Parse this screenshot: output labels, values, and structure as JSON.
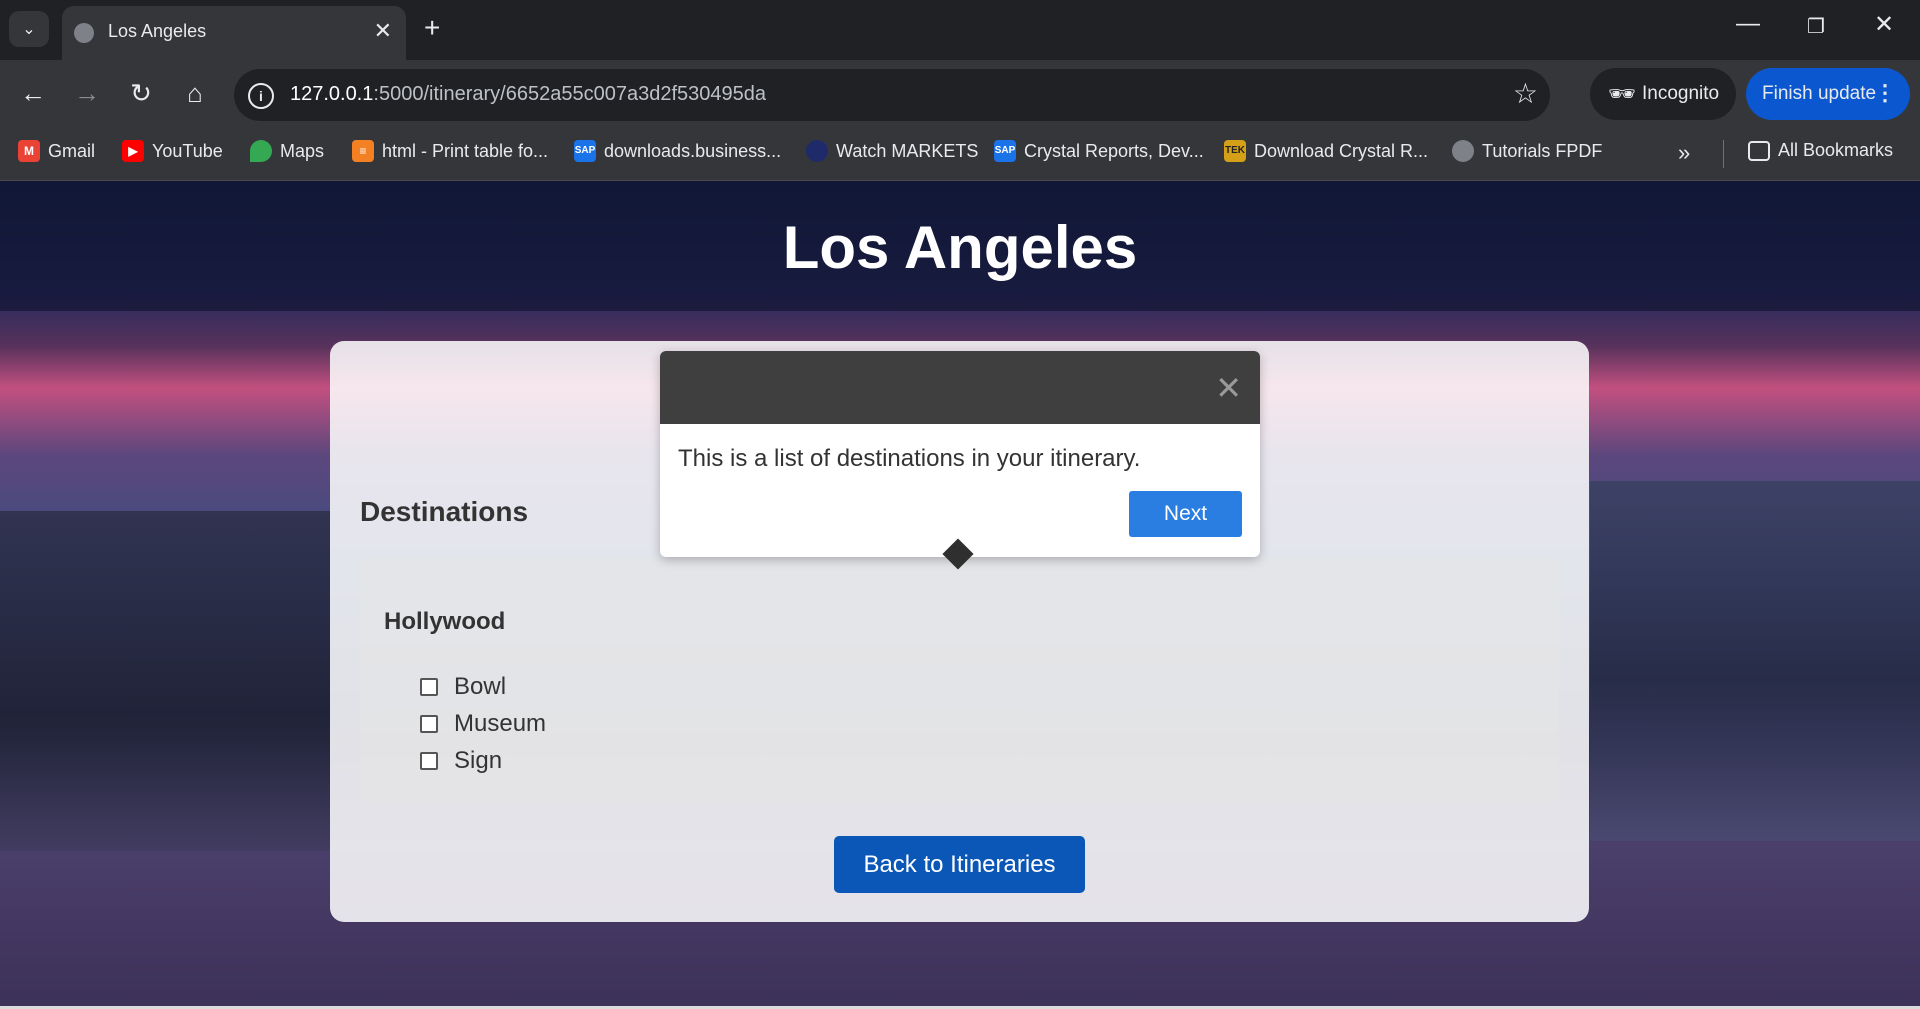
{
  "browser": {
    "tab_title": "Los Angeles",
    "url_host": "127.0.0.1",
    "url_path": ":5000/itinerary/6652a55c007a3d2f530495da",
    "incognito_label": "Incognito",
    "update_label": "Finish update",
    "bookmarks": [
      {
        "label": "Gmail",
        "icon": "gmail-icon",
        "color": "#ea4335"
      },
      {
        "label": "YouTube",
        "icon": "youtube-icon",
        "color": "#ff0000"
      },
      {
        "label": "Maps",
        "icon": "maps-icon",
        "color": "#34a853"
      },
      {
        "label": "html - Print table fo...",
        "icon": "stackoverflow-icon",
        "color": "#f48024"
      },
      {
        "label": "downloads.business...",
        "icon": "sap-icon",
        "color": "#1a73e8"
      },
      {
        "label": "Watch MARKETS",
        "icon": "markets-icon",
        "color": "#1f2a6b"
      },
      {
        "label": "Crystal Reports, Dev...",
        "icon": "sap-icon",
        "color": "#1a73e8"
      },
      {
        "label": "Download Crystal R...",
        "icon": "tek-icon",
        "color": "#d4a017"
      },
      {
        "label": "Tutorials FPDF",
        "icon": "globe-icon",
        "color": "#7e8187"
      }
    ],
    "all_bookmarks_label": "All Bookmarks"
  },
  "page": {
    "title": "Los Angeles",
    "section_title": "Destinations",
    "destination": {
      "name": "Hollywood",
      "items": [
        "Bowl",
        "Museum",
        "Sign"
      ]
    },
    "back_button": "Back to Itineraries"
  },
  "popover": {
    "text": "This is a list of destinations in your itinerary.",
    "next_label": "Next"
  }
}
